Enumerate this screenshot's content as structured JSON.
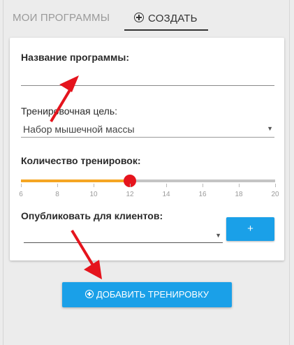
{
  "tabs": {
    "programs_label": "МОИ ПРОГРАММЫ",
    "create_label": "СОЗДАТЬ"
  },
  "form": {
    "name_label": "Название программы:",
    "name_value": "",
    "goal_label": "Тренировочная цель:",
    "goal_value": "Набор мышечной массы",
    "count_label": "Количество тренировок:",
    "publish_label": "Опубликовать для клиентов:",
    "publish_value": "",
    "plus_button_label": "+"
  },
  "slider": {
    "min": 6,
    "max": 20,
    "value": 12,
    "ticks": [
      "6",
      "8",
      "10",
      "12",
      "14",
      "16",
      "18",
      "20"
    ],
    "fill_color": "#f5a623",
    "knob_color": "#e5141d",
    "track_color": "#c4c4c4"
  },
  "add_training_label": "ДОБАВИТЬ ТРЕНИРОВКУ",
  "colors": {
    "accent": "#1aa0e8",
    "annotation_arrow": "#e5141d"
  }
}
